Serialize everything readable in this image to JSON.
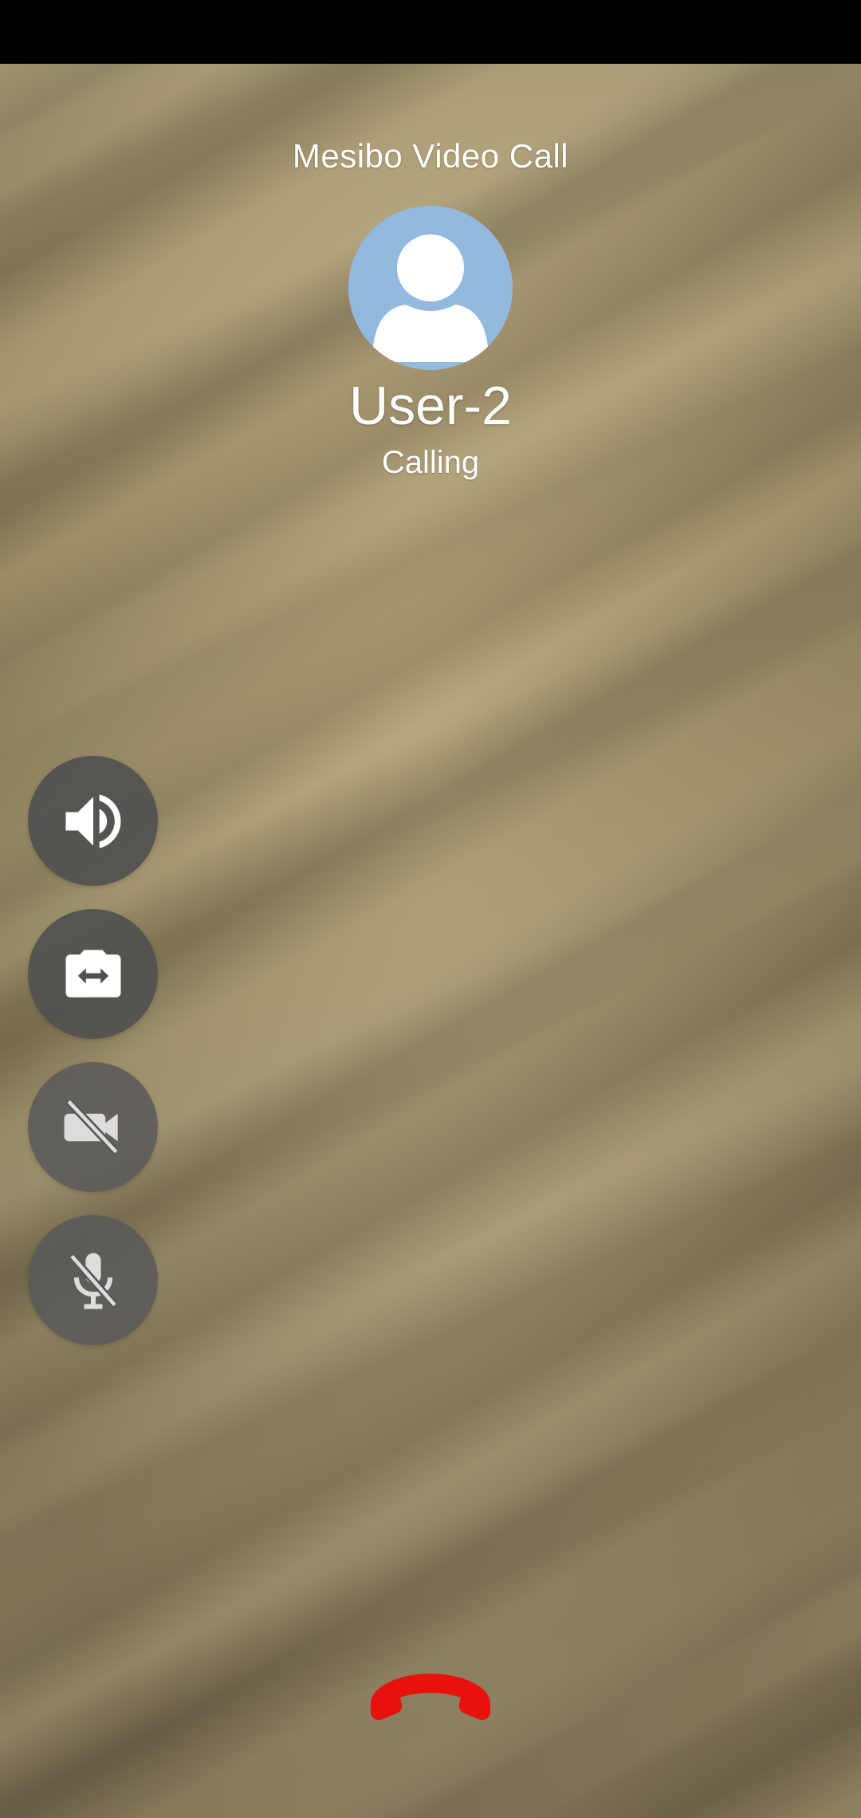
{
  "call": {
    "title": "Mesibo Video Call",
    "contact_name": "User-2",
    "status": "Calling"
  },
  "avatar": {
    "icon": "user-silhouette-icon",
    "background_color": "#93b9de"
  },
  "controls": [
    {
      "id": "speaker",
      "icon": "speaker-icon"
    },
    {
      "id": "switch-camera",
      "icon": "camera-switch-icon"
    },
    {
      "id": "video",
      "icon": "video-off-icon"
    },
    {
      "id": "microphone",
      "icon": "mic-off-icon"
    }
  ],
  "end_call": {
    "icon": "hang-up-icon",
    "color": "#e8120c"
  }
}
